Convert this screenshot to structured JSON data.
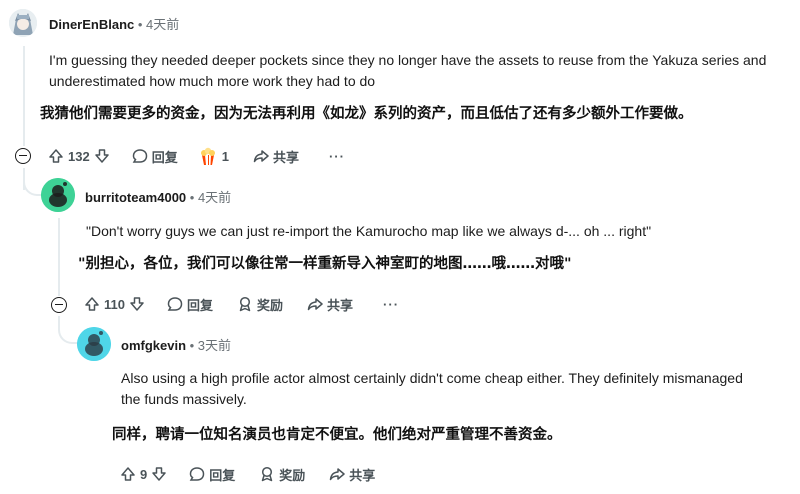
{
  "comments": [
    {
      "author": "DinerEnBlanc",
      "time": "• 4天前",
      "text_en": "I'm guessing they needed deeper pockets since they no longer have the assets to reuse from the Yakuza series and underestimated how much more work they had to do",
      "text_zh": "我猜他们需要更多的资金，因为无法再利用《如龙》系列的资产，而且低估了还有多少额外工作要做。",
      "votes": "132",
      "reply_label": "回复",
      "award_count": "1",
      "share_label": "共享",
      "more_label": "···"
    },
    {
      "author": "burritoteam4000",
      "time": "• 4天前",
      "text_en": "\"Don't worry guys we can just re-import the Kamurocho map like we always d-... oh ... right\"",
      "text_zh": "\"别担心，各位，我们可以像往常一样重新导入神室町的地图……哦……对哦\"",
      "votes": "110",
      "reply_label": "回复",
      "award_label": "奖励",
      "share_label": "共享",
      "more_label": "···"
    },
    {
      "author": "omfgkevin",
      "time": "• 3天前",
      "text_en": "Also using a high profile actor almost certainly didn't come cheap either. They definitely mismanaged the funds massively.",
      "text_zh": "同样，聘请一位知名演员也肯定不便宜。他们绝对严重管理不善资金。",
      "votes": "9",
      "reply_label": "回复",
      "award_label": "奖励",
      "share_label": "共享"
    }
  ],
  "colors": {
    "thread_line": "#e5ebee",
    "avatar_green": "#3ed296",
    "avatar_cyan": "#4fd6e8",
    "meta_gray": "#6a7176"
  }
}
